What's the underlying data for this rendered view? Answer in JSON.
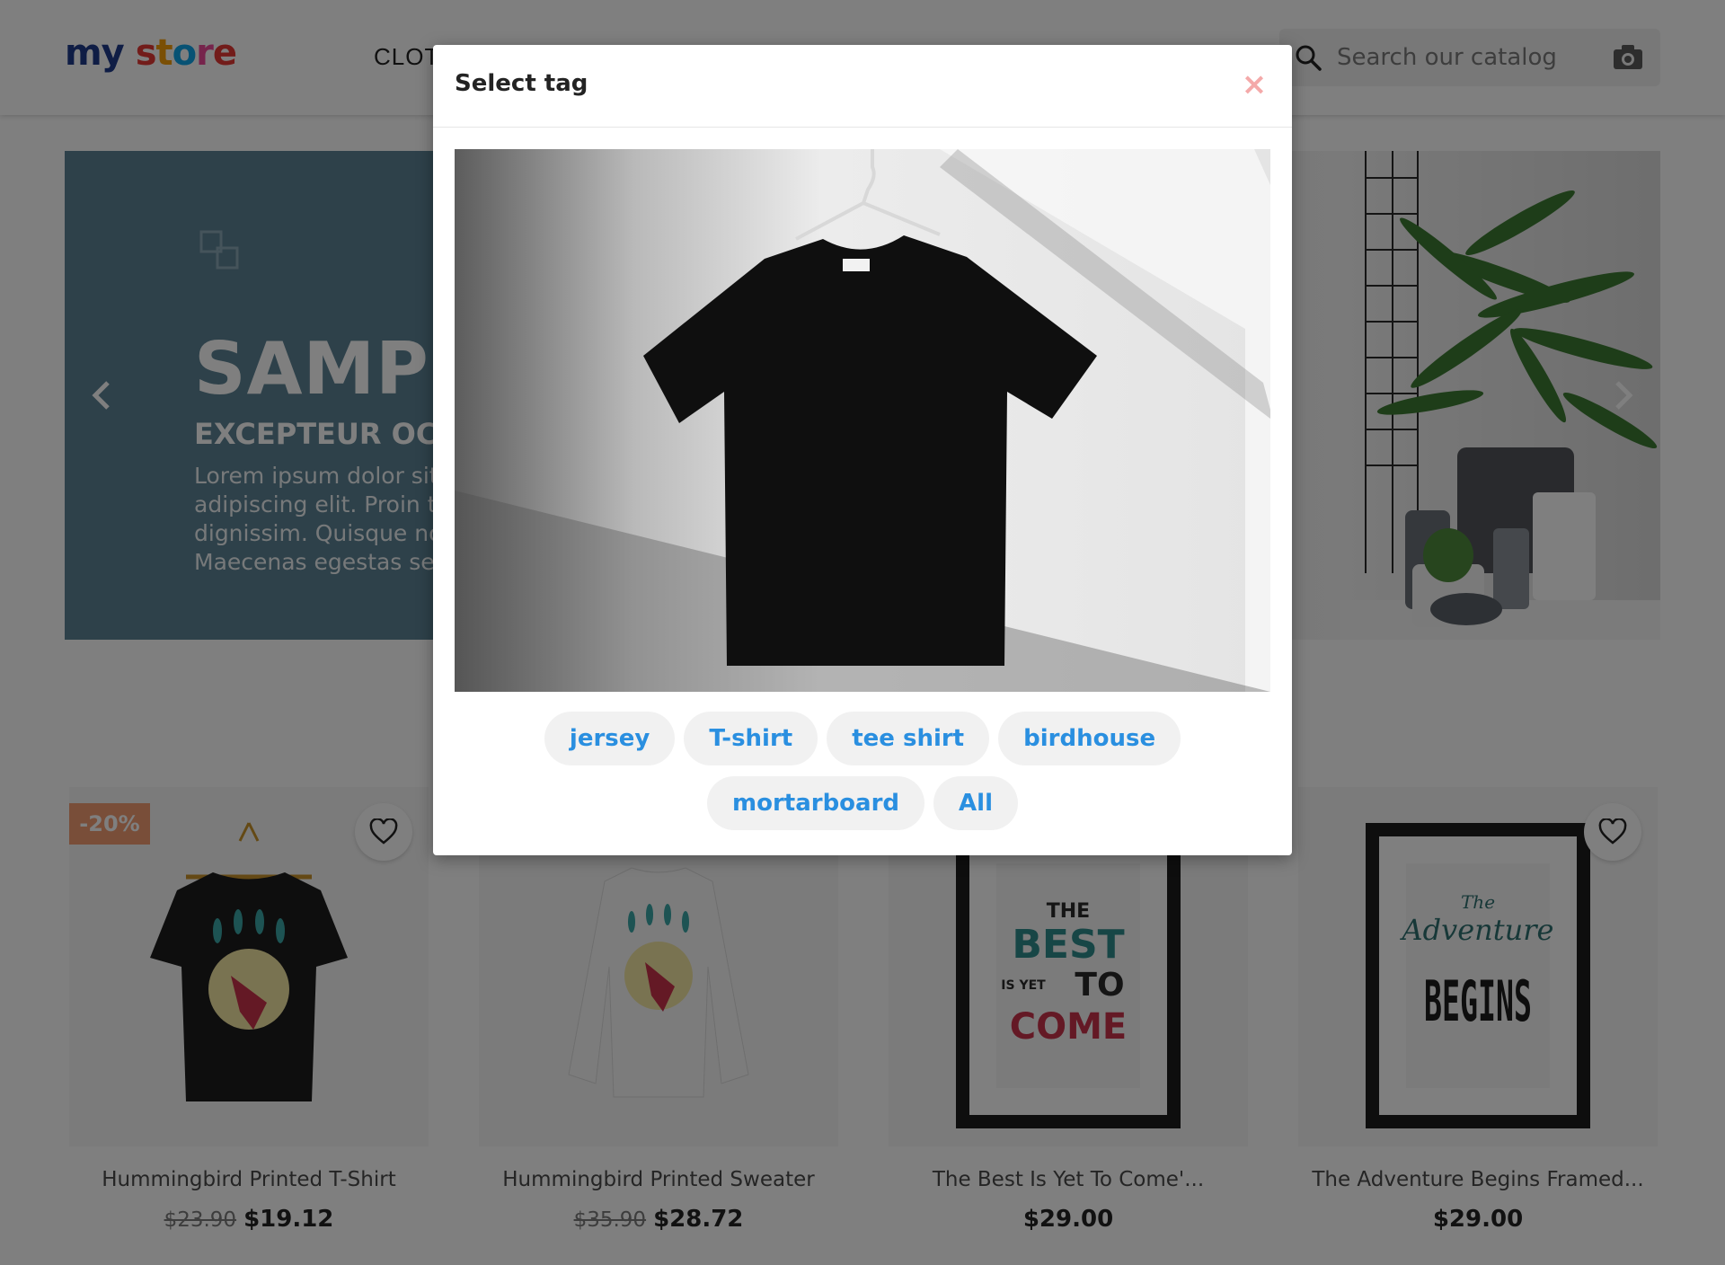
{
  "header": {
    "logo_parts": [
      "my",
      " ",
      "s",
      "t",
      "o",
      "r",
      "e"
    ],
    "logo_colors": [
      "#1e3a8a",
      "#1e3a8a",
      "#e53935",
      "#f59e0b",
      "#0ea5e9",
      "#ec4899",
      "#e53935"
    ],
    "nav_item": "CLOT",
    "search": {
      "placeholder": "Search our catalog",
      "icon": "search-icon",
      "camera_icon": "camera-icon"
    }
  },
  "hero": {
    "title": "SAMPL",
    "subtitle": "EXCEPTEUR OCC",
    "text_lines": [
      "Lorem ipsum dolor sit",
      "adipiscing elit. Proin t",
      "dignissim. Quisque no",
      "Maecenas egestas se"
    ],
    "prev_icon": "chevron-left-icon",
    "next_icon": "chevron-right-icon",
    "accent_color": "#5d8394"
  },
  "products": [
    {
      "name": "Hummingbird Printed T-Shirt",
      "old_price": "$23.90",
      "price": "$19.12",
      "badge": "-20%"
    },
    {
      "name": "Hummingbird Printed Sweater",
      "old_price": "$35.90",
      "price": "$28.72",
      "badge": ""
    },
    {
      "name": "The Best Is Yet To Come'...",
      "old_price": "",
      "price": "$29.00",
      "badge": ""
    },
    {
      "name": "The Adventure Begins Framed...",
      "old_price": "",
      "price": "$29.00",
      "badge": ""
    }
  ],
  "poster_best": {
    "line1": "THE",
    "line2": "BEST",
    "line3a": "IS YET",
    "line3b": "TO",
    "line4": "COME"
  },
  "poster_adventure": {
    "line1": "The",
    "line2": "Adventure",
    "line3": "BEGINS"
  },
  "modal": {
    "title": "Select tag",
    "close_label": "×",
    "tags": [
      "jersey",
      "T-shirt",
      "tee shirt",
      "birdhouse",
      "mortarboard",
      "All"
    ],
    "tag_color": "#2a8fe0",
    "close_color": "#f4a9a9"
  }
}
